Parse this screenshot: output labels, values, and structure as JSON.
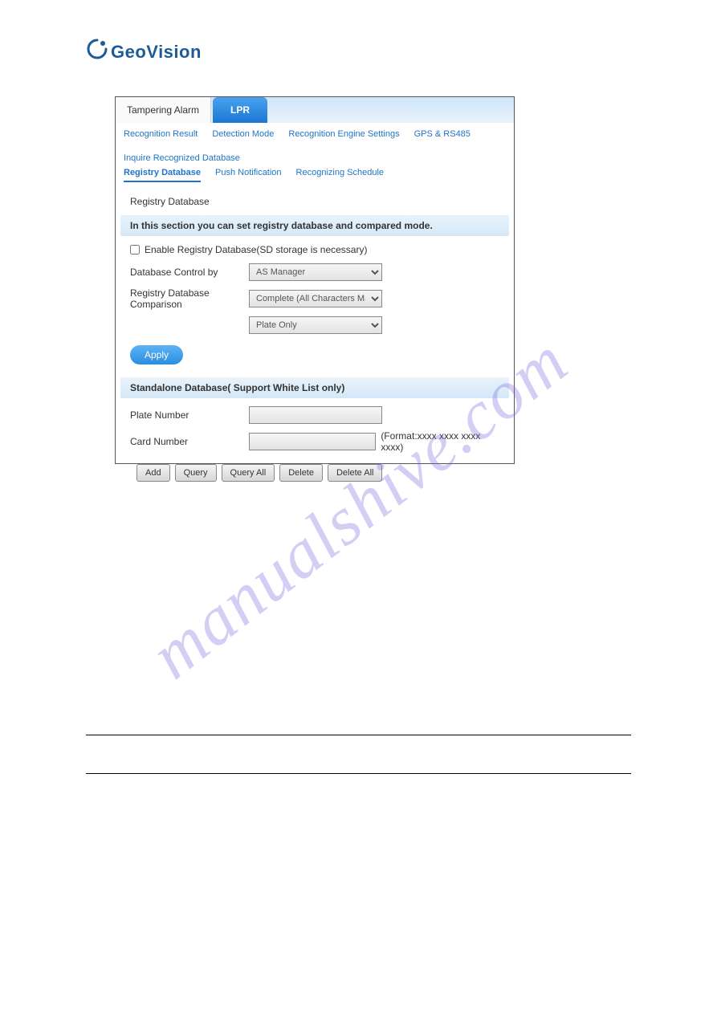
{
  "logo": {
    "brand": "GeoVision"
  },
  "tabs": {
    "plain": "Tampering Alarm",
    "active": "LPR"
  },
  "subnav1": {
    "items": [
      "Recognition Result",
      "Detection Mode",
      "Recognition Engine Settings",
      "GPS & RS485",
      "Inquire Recognized Database"
    ]
  },
  "subnav2": {
    "items": [
      "Registry Database",
      "Push Notification",
      "Recognizing Schedule"
    ],
    "active_index": 0
  },
  "section_label": "Registry Database",
  "banner1": "In this section you can set registry database and compared mode.",
  "enable_label": "Enable Registry Database(SD storage is necessary)",
  "fields": {
    "db_control_label": "Database Control by",
    "db_control_value": "AS Manager",
    "comparison_label": "Registry Database Comparison",
    "comparison_value": "Complete (All Characters Match)",
    "plate_only_value": "Plate Only"
  },
  "apply_label": "Apply",
  "banner2": "Standalone Database( Support White List only)",
  "standalone": {
    "plate_label": "Plate Number",
    "card_label": "Card Number",
    "card_hint": "(Format:xxxx xxxx xxxx xxxx)"
  },
  "buttons": {
    "add": "Add",
    "query": "Query",
    "query_all": "Query All",
    "delete": "Delete",
    "delete_all": "Delete All"
  },
  "watermark": "manualshive.com"
}
